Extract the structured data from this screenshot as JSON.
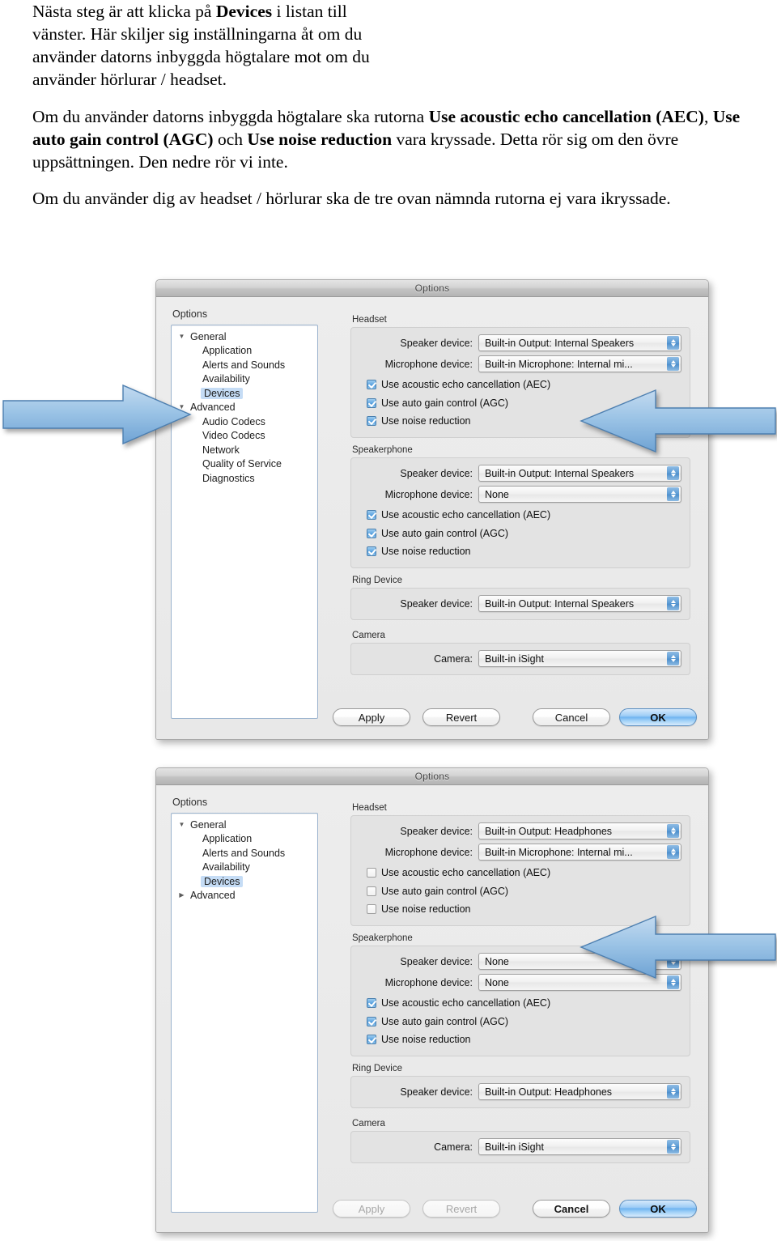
{
  "prose": {
    "p1": "Nästa steg är att klicka på |Devices| i listan till vänster. Här skiljer sig inställningarna åt om du använder datorns inbyggda högtalare mot om du använder hörlurar / headset.",
    "p2_a": "Om du använder datorns inbyggda högtalare ska rutorna ",
    "p2_b1": "Use acoustic echo cancellation (AEC)",
    "p2_c": ", ",
    "p2_b2": "Use auto gain control (AGC)",
    "p2_d": " och ",
    "p2_b3": "Use noise reduction",
    "p2_e": " vara kryssade. Detta rör sig om den övre uppsättningen. Den nedre rör vi inte.",
    "p3": "Om du använder dig av headset / hörlurar ska de tre ovan nämnda rutorna ej vara ikryssade.",
    "p1_pre": "Nästa steg är att klicka på ",
    "p1_bold": "Devices",
    "p1_post": " i listan till vänster. Här skiljer sig inställningarna åt om du använder datorns inbyggda högtalare mot om du använder hörlurar / headset."
  },
  "dialog1": {
    "title": "Options",
    "sidebar": {
      "caption": "Options",
      "items": [
        {
          "label": "General",
          "level": "root",
          "twist": "▼",
          "selected": false
        },
        {
          "label": "Application",
          "level": "child",
          "twist": "",
          "selected": false
        },
        {
          "label": "Alerts and Sounds",
          "level": "child",
          "twist": "",
          "selected": false
        },
        {
          "label": "Availability",
          "level": "child",
          "twist": "",
          "selected": false
        },
        {
          "label": "Devices",
          "level": "child",
          "twist": "",
          "selected": true
        },
        {
          "label": "Advanced",
          "level": "root",
          "twist": "▼",
          "selected": false
        },
        {
          "label": "Audio Codecs",
          "level": "child",
          "twist": "",
          "selected": false
        },
        {
          "label": "Video Codecs",
          "level": "child",
          "twist": "",
          "selected": false
        },
        {
          "label": "Network",
          "level": "child",
          "twist": "",
          "selected": false
        },
        {
          "label": "Quality of Service",
          "level": "child",
          "twist": "",
          "selected": false
        },
        {
          "label": "Diagnostics",
          "level": "child",
          "twist": "",
          "selected": false
        }
      ]
    },
    "headset": {
      "title": "Headset",
      "speaker_label": "Speaker device:",
      "speaker_value": "Built-in Output: Internal Speakers",
      "mic_label": "Microphone device:",
      "mic_value": "Built-in Microphone: Internal mi...",
      "aec_label": "Use acoustic echo cancellation (AEC)",
      "aec_checked": true,
      "agc_label": "Use auto gain control (AGC)",
      "agc_checked": true,
      "nr_label": "Use noise reduction",
      "nr_checked": true
    },
    "speakerphone": {
      "title": "Speakerphone",
      "speaker_label": "Speaker device:",
      "speaker_value": "Built-in Output: Internal Speakers",
      "mic_label": "Microphone device:",
      "mic_value": "None",
      "aec_label": "Use acoustic echo cancellation (AEC)",
      "aec_checked": true,
      "agc_label": "Use auto gain control (AGC)",
      "agc_checked": true,
      "nr_label": "Use noise reduction",
      "nr_checked": true
    },
    "ring": {
      "title": "Ring Device",
      "speaker_label": "Speaker device:",
      "speaker_value": "Built-in Output: Internal Speakers"
    },
    "camera": {
      "title": "Camera",
      "camera_label": "Camera:",
      "camera_value": "Built-in iSight"
    },
    "buttons": {
      "apply": "Apply",
      "revert": "Revert",
      "cancel": "Cancel",
      "ok": "OK",
      "apply_disabled": false,
      "revert_disabled": false
    }
  },
  "dialog2": {
    "title": "Options",
    "sidebar": {
      "caption": "Options",
      "items": [
        {
          "label": "General",
          "level": "root",
          "twist": "▼",
          "selected": false
        },
        {
          "label": "Application",
          "level": "child",
          "twist": "",
          "selected": false
        },
        {
          "label": "Alerts and Sounds",
          "level": "child",
          "twist": "",
          "selected": false
        },
        {
          "label": "Availability",
          "level": "child",
          "twist": "",
          "selected": false
        },
        {
          "label": "Devices",
          "level": "child",
          "twist": "",
          "selected": true
        },
        {
          "label": "Advanced",
          "level": "root",
          "twist": "▶",
          "selected": false
        }
      ]
    },
    "headset": {
      "title": "Headset",
      "speaker_label": "Speaker device:",
      "speaker_value": "Built-in Output: Headphones",
      "mic_label": "Microphone device:",
      "mic_value": "Built-in Microphone: Internal mi...",
      "aec_label": "Use acoustic echo cancellation (AEC)",
      "aec_checked": false,
      "agc_label": "Use auto gain control (AGC)",
      "agc_checked": false,
      "nr_label": "Use noise reduction",
      "nr_checked": false
    },
    "speakerphone": {
      "title": "Speakerphone",
      "speaker_label": "Speaker device:",
      "speaker_value": "None",
      "mic_label": "Microphone device:",
      "mic_value": "None",
      "aec_label": "Use acoustic echo cancellation (AEC)",
      "aec_checked": true,
      "agc_label": "Use auto gain control (AGC)",
      "agc_checked": true,
      "nr_label": "Use noise reduction",
      "nr_checked": true
    },
    "ring": {
      "title": "Ring Device",
      "speaker_label": "Speaker device:",
      "speaker_value": "Built-in Output: Headphones"
    },
    "camera": {
      "title": "Camera",
      "camera_label": "Camera:",
      "camera_value": "Built-in iSight"
    },
    "buttons": {
      "apply": "Apply",
      "revert": "Revert",
      "cancel": "Cancel",
      "ok": "OK",
      "apply_disabled": true,
      "revert_disabled": true
    }
  },
  "annotations": {
    "arrow_color_light": "#a8cbe8",
    "arrow_color_dark": "#5b92c8",
    "arrow1_direction": "right",
    "arrow2_direction": "left",
    "arrow3_direction": "left"
  }
}
